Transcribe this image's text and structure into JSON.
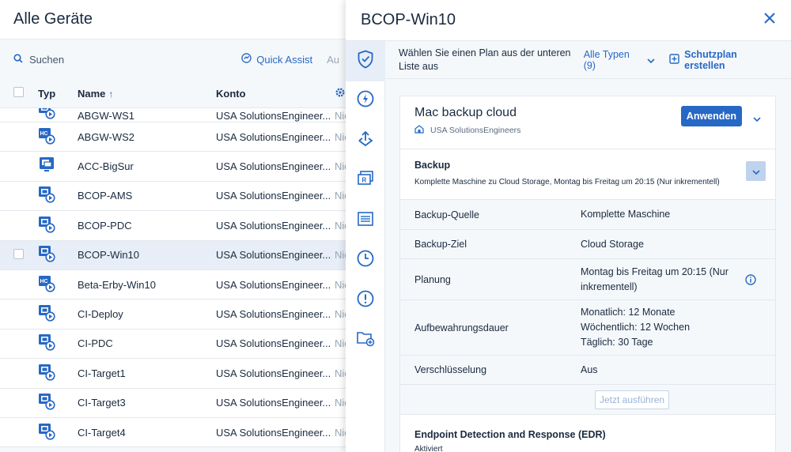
{
  "left": {
    "title": "Alle Geräte",
    "search_label": "Suchen",
    "quick_assist": "Quick Assist",
    "truncated_action": "Au",
    "columns": {
      "type": "Typ",
      "name": "Name",
      "account": "Konto"
    },
    "rows": [
      {
        "name": "ABGW-WS1",
        "account": "USA SolutionsEngineer...",
        "more": "Nic",
        "icon": "vm-icon"
      },
      {
        "name": "ABGW-WS2",
        "account": "USA SolutionsEngineer...",
        "more": "Nic",
        "icon": "hc-icon"
      },
      {
        "name": "ACC-BigSur",
        "account": "USA SolutionsEngineer...",
        "more": "Nic",
        "icon": "mac-icon"
      },
      {
        "name": "BCOP-AMS",
        "account": "USA SolutionsEngineer...",
        "more": "Nic",
        "icon": "vm-icon"
      },
      {
        "name": "BCOP-PDC",
        "account": "USA SolutionsEngineer...",
        "more": "Nic",
        "icon": "vm-icon"
      },
      {
        "name": "BCOP-Win10",
        "account": "USA SolutionsEngineer...",
        "more": "Nic",
        "icon": "vm-icon"
      },
      {
        "name": "Beta-Erby-Win10",
        "account": "USA SolutionsEngineer...",
        "more": "Nic",
        "icon": "hc-icon"
      },
      {
        "name": "CI-Deploy",
        "account": "USA SolutionsEngineer...",
        "more": "Nic",
        "icon": "vm-icon"
      },
      {
        "name": "CI-PDC",
        "account": "USA SolutionsEngineer...",
        "more": "Nic",
        "icon": "vm-icon"
      },
      {
        "name": "CI-Target1",
        "account": "USA SolutionsEngineer...",
        "more": "Nic",
        "icon": "vm-icon"
      },
      {
        "name": "CI-Target3",
        "account": "USA SolutionsEngineer...",
        "more": "Nic",
        "icon": "vm-icon"
      },
      {
        "name": "CI-Target4",
        "account": "USA SolutionsEngineer...",
        "more": "Nic",
        "icon": "vm-icon"
      }
    ]
  },
  "right": {
    "title": "BCOP-Win10",
    "plan_hint": "Wählen Sie einen Plan aus der unteren Liste aus",
    "types_filter": "Alle Typen (9)",
    "create_plan": "Schutzplan erstellen",
    "plan": {
      "name": "Mac backup cloud",
      "org": "USA SolutionsEngineers",
      "apply": "Anwenden"
    },
    "backup": {
      "title": "Backup",
      "subtitle": "Komplette Maschine zu Cloud Storage, Montag bis Freitag um 20:15 (Nur inkrementell)",
      "details": [
        {
          "label": "Backup-Quelle",
          "value": "Komplette Maschine"
        },
        {
          "label": "Backup-Ziel",
          "value": "Cloud Storage"
        },
        {
          "label": "Planung",
          "value": "Montag bis Freitag um 20:15 (Nur inkrementell)"
        },
        {
          "label": "Aufbewahrungsdauer",
          "value_lines": [
            "Monatlich: 12 Monate",
            "Wöchentlich: 12 Wochen",
            "Täglich: 30 Tage"
          ]
        },
        {
          "label": "Verschlüsselung",
          "value": "Aus"
        }
      ],
      "run_now": "Jetzt ausführen"
    },
    "edr": {
      "title": "Endpoint Detection and Response (EDR)",
      "status": "Aktiviert"
    }
  },
  "colors": {
    "accent": "#2668c5",
    "panel_bg": "#f5f8fb",
    "selected_row": "#e8eef7"
  }
}
